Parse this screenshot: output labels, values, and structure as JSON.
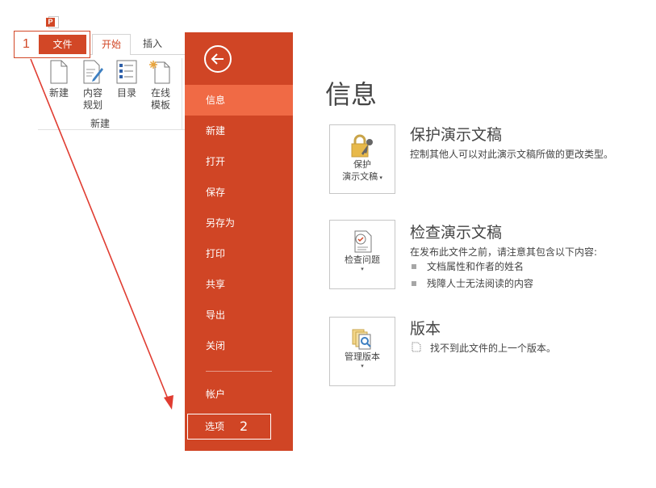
{
  "app": {
    "icon": "powerpoint-icon",
    "accent": "#d24726",
    "nav_bg": "#d04525",
    "nav_active_bg": "#f06a45"
  },
  "annotations": {
    "step1": "1",
    "step2": "2",
    "arrow_color": "#e03c31"
  },
  "ribbon": {
    "tabs": [
      {
        "label": "文件"
      },
      {
        "label": "开始"
      },
      {
        "label": "插入"
      }
    ],
    "group": {
      "label": "新建",
      "buttons": [
        {
          "label": "新建",
          "icon": "new-document-icon"
        },
        {
          "label": "内容\n规划",
          "icon": "content-plan-icon"
        },
        {
          "label": "目录",
          "icon": "table-of-contents-icon"
        },
        {
          "label": "在线\n模板",
          "icon": "online-template-icon"
        }
      ]
    }
  },
  "nav": {
    "back_icon": "back-arrow-icon",
    "items": [
      {
        "label": "信息"
      },
      {
        "label": "新建"
      },
      {
        "label": "打开"
      },
      {
        "label": "保存"
      },
      {
        "label": "另存为"
      },
      {
        "label": "打印"
      },
      {
        "label": "共享"
      },
      {
        "label": "导出"
      },
      {
        "label": "关闭"
      },
      {
        "label": "帐户"
      },
      {
        "label": "选项"
      }
    ]
  },
  "info": {
    "title": "信息",
    "protect": {
      "button_line1": "保护",
      "button_line2": "演示文稿",
      "title": "保护演示文稿",
      "desc": "控制其他人可以对此演示文稿所做的更改类型。"
    },
    "inspect": {
      "button": "检查问题",
      "title": "检查演示文稿",
      "desc": "在发布此文件之前，请注意其包含以下内容:",
      "bullets": [
        "文档属性和作者的姓名",
        "残障人士无法阅读的内容"
      ]
    },
    "version": {
      "button": "管理版本",
      "title": "版本",
      "desc": "找不到此文件的上一个版本。"
    }
  }
}
